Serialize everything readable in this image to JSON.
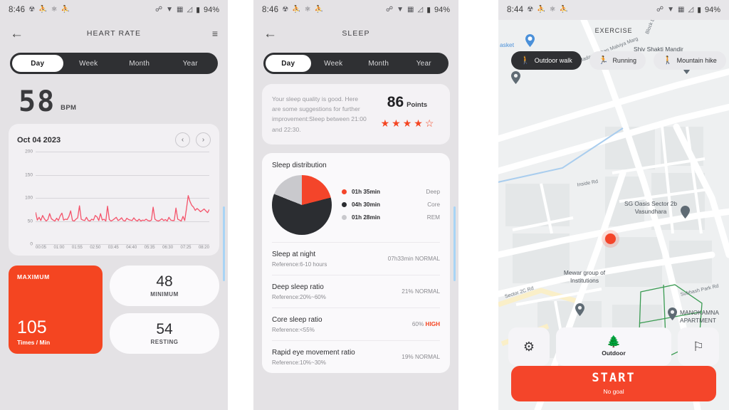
{
  "panels": {
    "heart_rate": {
      "status_bar": {
        "time": "8:46",
        "battery": "94%",
        "left_icons": [
          "notification-icon",
          "message-icon",
          "app-icon",
          "message-icon"
        ],
        "right_icons": [
          "bluetooth-icon",
          "wifi-icon",
          "vpn-icon",
          "signal-icon",
          "battery-icon"
        ]
      },
      "app_bar": {
        "back": "←",
        "title": "HEART RATE",
        "menu": "≡"
      },
      "tabs": [
        {
          "label": "Day",
          "active": true
        },
        {
          "label": "Week",
          "active": false
        },
        {
          "label": "Month",
          "active": false
        },
        {
          "label": "Year",
          "active": false
        }
      ],
      "reading": {
        "value": "58",
        "unit": "BPM"
      },
      "chart_card": {
        "date": "Oct 04  2023",
        "prev": "‹",
        "next": "›"
      },
      "stats": {
        "maximum": {
          "label": "MAXIMUM",
          "value": "105",
          "unit": "Times / Min"
        },
        "minimum": {
          "value": "48",
          "label": "MINIMUM"
        },
        "resting": {
          "value": "54",
          "label": "RESTING"
        }
      }
    },
    "sleep": {
      "status_bar": {
        "time": "8:46",
        "battery": "94%"
      },
      "app_bar": {
        "back": "←",
        "title": "SLEEP"
      },
      "tabs": [
        {
          "label": "Day",
          "active": true
        },
        {
          "label": "Week",
          "active": false
        },
        {
          "label": "Month",
          "active": false
        },
        {
          "label": "Year",
          "active": false
        }
      ],
      "quality": {
        "advice": "Your sleep quality is good. Here are some suggestions for further improvement:Sleep between 21:00 and 22:30.",
        "score": "86",
        "score_unit": "Points",
        "stars_filled": 4,
        "stars_total": 5
      },
      "distribution": {
        "title": "Sleep distribution",
        "legend": [
          {
            "value": "01h 35min",
            "name": "Deep",
            "color": "#f4452a"
          },
          {
            "value": "04h 30min",
            "name": "Core",
            "color": "#2b2d31"
          },
          {
            "value": "01h 28min",
            "name": "REM",
            "color": "#c9c9cd"
          }
        ]
      },
      "metrics": [
        {
          "name": "Sleep at night",
          "reference": "Reference:6-10 hours",
          "value": "07h33min",
          "status": "NORMAL",
          "highlight": false
        },
        {
          "name": "Deep sleep ratio",
          "reference": "Reference:20%~60%",
          "value": "21%",
          "status": "NORMAL",
          "highlight": false
        },
        {
          "name": "Core sleep ratio",
          "reference": "Reference:<55%",
          "value": "60%",
          "status": "HIGH",
          "highlight": true
        },
        {
          "name": "Rapid eye movement ratio",
          "reference": "Reference:10%~30%",
          "value": "19%",
          "status": "NORMAL",
          "highlight": false
        }
      ]
    },
    "exercise": {
      "status_bar": {
        "time": "8:44",
        "battery": "94%"
      },
      "title": "EXERCISE",
      "chips": [
        {
          "label": "Outdoor walk",
          "icon": "walk-icon",
          "active": true
        },
        {
          "label": "Running",
          "icon": "run-icon",
          "active": false
        },
        {
          "label": "Mountain hike",
          "icon": "hike-icon",
          "active": false
        }
      ],
      "map_labels": [
        {
          "text": "asket",
          "type": "poi"
        },
        {
          "text": "Shiv Shakti Mandir",
          "type": "poi"
        },
        {
          "text": "Madan Mohan Malviya Marg",
          "type": "road"
        },
        {
          "text": "Block Ln",
          "type": "road"
        },
        {
          "text": "Inside Rd",
          "type": "road"
        },
        {
          "text": "SG Oasis Sector 2b Vasundhara",
          "type": "poi"
        },
        {
          "text": "Mewar group of Institutions",
          "type": "poi"
        },
        {
          "text": "Sector 2C Rd",
          "type": "road"
        },
        {
          "text": "Subhash Park Rd",
          "type": "road"
        },
        {
          "text": "MANOKAMNA APARTMENT",
          "type": "poi"
        }
      ],
      "controls": [
        {
          "name": "settings",
          "icon": "gear-icon",
          "label": ""
        },
        {
          "name": "mode",
          "icon": "outdoor-icon",
          "label": "Outdoor"
        },
        {
          "name": "goal",
          "icon": "flag-icon",
          "label": ""
        }
      ],
      "start": {
        "label": "START",
        "sub": "No goal"
      }
    }
  },
  "chart_data": [
    {
      "type": "line",
      "title": "Oct 04  2023",
      "xlabel": "",
      "ylabel": "",
      "ylim": [
        0,
        200
      ],
      "yticks": [
        0,
        50,
        100,
        150,
        200
      ],
      "grid": true,
      "color": "#f4536a",
      "x": [
        "00:05",
        "01:00",
        "01:55",
        "02:50",
        "03:45",
        "04:40",
        "05:35",
        "06:30",
        "07:25",
        "08:20"
      ],
      "values": [
        69,
        52,
        58,
        51,
        62,
        55,
        50,
        53,
        66,
        55,
        52,
        50,
        56,
        51,
        61,
        67,
        52,
        54,
        53,
        60,
        72,
        51,
        50,
        54,
        57,
        83,
        54,
        52,
        51,
        58,
        51,
        50,
        54,
        52,
        62,
        59,
        51,
        66,
        52,
        54,
        50,
        82,
        53,
        50,
        52,
        55,
        58,
        51,
        53,
        57,
        51,
        50,
        56,
        53,
        52,
        51,
        57,
        52,
        50,
        54,
        50,
        52,
        51,
        54,
        51,
        50,
        52,
        80,
        54,
        51,
        50,
        52,
        55,
        51,
        53,
        50,
        58,
        52,
        51,
        51,
        78,
        54,
        52,
        50,
        60,
        51,
        77,
        105,
        92,
        84,
        80,
        73,
        77,
        74,
        70,
        73,
        76,
        72,
        68,
        75
      ]
    },
    {
      "type": "pie",
      "title": "Sleep distribution",
      "categories": [
        "Deep",
        "Core",
        "REM"
      ],
      "labels": [
        "01h 35min",
        "04h 30min",
        "01h 28min"
      ],
      "values": [
        21,
        60,
        19
      ],
      "colors": [
        "#f4452a",
        "#2b2d31",
        "#c9c9cd"
      ],
      "legend": "right"
    }
  ]
}
